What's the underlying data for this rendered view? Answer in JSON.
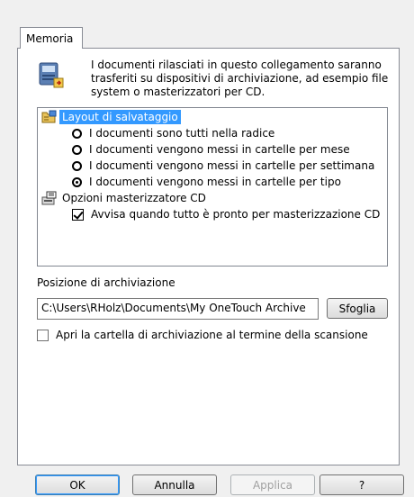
{
  "tab": {
    "label": "Memoria"
  },
  "header": {
    "icon": "storage-icon",
    "text": "I documenti rilasciati in questo collegamento saranno trasferiti su dispositivi di archiviazione, ad esempio file system o masterizzatori per CD."
  },
  "tree": {
    "layout": {
      "label": "Layout di salvataggio",
      "icon": "folder-layout-icon",
      "selected": true,
      "options": [
        {
          "label": "I documenti sono tutti nella radice",
          "checked": false
        },
        {
          "label": "I documenti vengono messi in cartelle per mese",
          "checked": false
        },
        {
          "label": "I documenti vengono messi in cartelle per settimana",
          "checked": false
        },
        {
          "label": "I documenti vengono messi in cartelle per tipo",
          "checked": true
        }
      ]
    },
    "cd": {
      "label": "Opzioni masterizzatore CD",
      "icon": "cd-burner-icon",
      "options": [
        {
          "label": "Avvisa quando tutto è pronto per masterizzazione CD",
          "checked": true
        }
      ]
    }
  },
  "archive": {
    "label": "Posizione di archiviazione",
    "path": "C:\\Users\\RHolz\\Documents\\My OneTouch Archive",
    "browse_label": "Sfoglia"
  },
  "open_folder": {
    "label": "Apri la cartella di archiviazione al termine della scansione",
    "checked": false
  },
  "buttons": {
    "ok": "OK",
    "cancel": "Annulla",
    "apply": "Applica",
    "help": "?"
  }
}
